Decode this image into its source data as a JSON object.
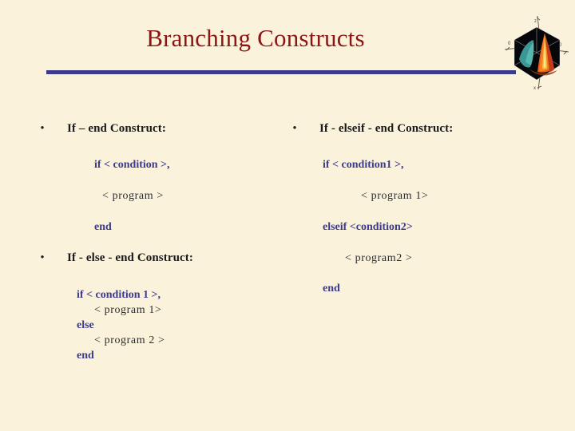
{
  "slide": {
    "title": "Branching Constructs",
    "background_color": "#fbf2dc",
    "title_color": "#8c1515",
    "rule_color": "#3b3a8c",
    "keyword_color": "#3b3a8c",
    "plain_color": "#2b2b2b",
    "bullet_glyph": "•"
  },
  "logo": {
    "name": "matlab-membrane-logo"
  },
  "left_column": {
    "section1": {
      "heading": "If – end Construct:",
      "lines": {
        "condition": "if < condition >,",
        "program": "< program >",
        "end": "end"
      }
    },
    "section2": {
      "heading": "If - else - end Construct:",
      "lines": {
        "condition": "if < condition 1 >,",
        "program1": "< program 1>",
        "else": "else",
        "program2": "< program 2 >",
        "end": "end"
      }
    }
  },
  "right_column": {
    "section1": {
      "heading": "If - elseif - end Construct:",
      "lines": {
        "condition1": "if < condition1 >,",
        "program1": "< program 1>",
        "elseif": "elseif <condition2>",
        "program2": "< program2 >",
        "end": "end"
      }
    }
  }
}
